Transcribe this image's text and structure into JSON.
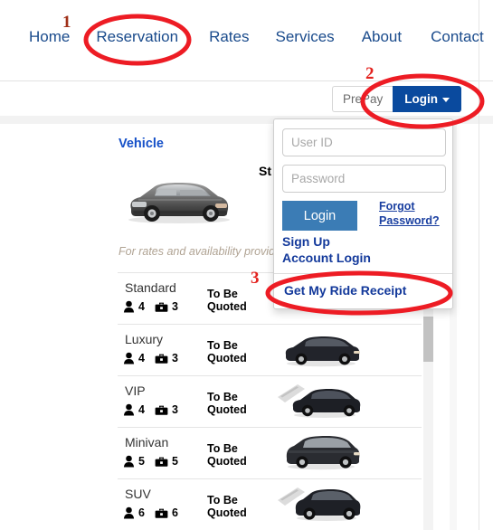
{
  "nav": {
    "items": [
      {
        "label": "Home",
        "name": "nav-home"
      },
      {
        "label": "Reservation",
        "name": "nav-reservation"
      },
      {
        "label": "Rates",
        "name": "nav-rates"
      },
      {
        "label": "Services",
        "name": "nav-services"
      },
      {
        "label": "About",
        "name": "nav-about"
      },
      {
        "label": "Contact",
        "name": "nav-contact"
      }
    ]
  },
  "actionbar": {
    "prepay_label": "PrePay",
    "login_label": "Login",
    "caret_icon": "chevron-down-icon"
  },
  "login_dropdown": {
    "userid_placeholder": "User ID",
    "userid_value": "",
    "password_placeholder": "Password",
    "password_value": "",
    "login_button_label": "Login",
    "forgot_password_label": "Forgot Password?",
    "sign_up_label": "Sign Up",
    "account_login_label": "Account Login",
    "get_receipt_label": "Get My Ride Receipt"
  },
  "content": {
    "vehicle_heading": "Vehicle",
    "standard_label": "St",
    "rates_note": "For rates and availability provide",
    "hero_car_icon": "sedan-car-image"
  },
  "vehicle_list": {
    "rows": [
      {
        "name": "Standard",
        "price": "To Be Quoted",
        "passengers": "4",
        "luggage": "3",
        "thumb": "standard-sedan-thumb"
      },
      {
        "name": "Luxury",
        "price": "To Be Quoted",
        "passengers": "4",
        "luggage": "3",
        "thumb": "luxury-sedan-thumb"
      },
      {
        "name": "VIP",
        "price": "To Be Quoted",
        "passengers": "4",
        "luggage": "3",
        "thumb": "vip-sedan-thumb"
      },
      {
        "name": "Minivan",
        "price": "To Be Quoted",
        "passengers": "5",
        "luggage": "5",
        "thumb": "minivan-thumb"
      },
      {
        "name": "SUV",
        "price": "To Be Quoted",
        "passengers": "6",
        "luggage": "6",
        "thumb": "suv-thumb"
      }
    ],
    "person_icon": "person-icon",
    "luggage_icon": "briefcase-icon"
  },
  "annotations": {
    "marker_1": "1",
    "marker_2": "2",
    "marker_3": "3",
    "ellipse_color": "#ed1c24",
    "marker_color": "#e3221e"
  },
  "colors": {
    "nav_link": "#1a4b8c",
    "primary_blue": "#0a4a9e",
    "dropdown_button_blue": "#3b7cb5",
    "link_blue": "#13399b",
    "heading_blue": "#1550c8",
    "note_gray": "#b0a393"
  }
}
